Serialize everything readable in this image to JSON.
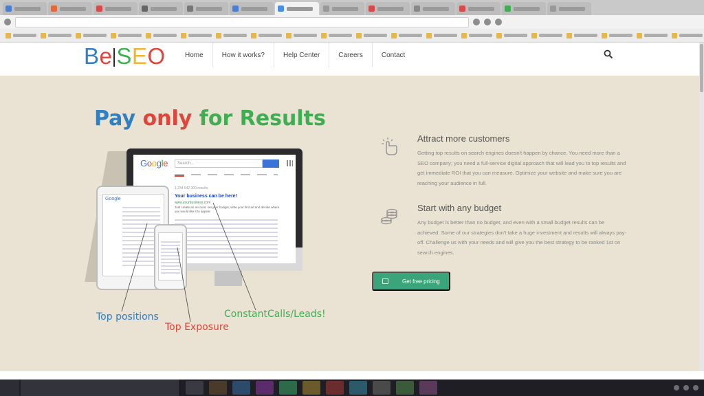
{
  "site": {
    "logo": {
      "b": "B",
      "e": "e",
      "s": "S",
      "e2": "E",
      "o": "O"
    },
    "nav": [
      "Home",
      "How it works?",
      "Help Center",
      "Careers",
      "Contact"
    ]
  },
  "hero": {
    "headline": {
      "w1": "Pay",
      "w2": "only",
      "w3": "for Results"
    },
    "illustration": {
      "search_placeholder": "Search...",
      "results_count": "1 234 542 300 results",
      "result_title": "Your business can be here!",
      "result_url": "www.yourbusiness.com",
      "result_desc": "Just create an account, set your budget, write your first ad and decide where you would like it to appear"
    },
    "labels": {
      "top_positions": "Top positions",
      "top_exposure": "Top Exposure",
      "calls": "ConstantCalls/Leads!"
    }
  },
  "features": [
    {
      "icon": "touch-click-icon",
      "title": "Attract more customers",
      "body": "Getting top results on search engines doesn't happen by chance. You need more than a SEO company; you need a full-service digital approach that will lead you to top results and get immediate ROI that you can measure. Optimize your website and make sure you are reaching your audience in full."
    },
    {
      "icon": "coins-icon",
      "title": "Start with any budget",
      "body": "Any budget is better than no budget, and even with a small budget results can be achieved. Some of our strategies don't take a huge investment and results will always pay-off. Challenge us with your needs and will give you the best strategy to be ranked 1st on search engines."
    }
  ],
  "cta": {
    "label": "Get free pricing",
    "icon": "calculator-icon"
  },
  "colors": {
    "blue": "#2f7fc4",
    "red": "#e0443a",
    "green": "#3fae53",
    "yellow": "#f1b52f",
    "hero_bg": "#eae2d2",
    "cta_bg": "#3aa57a"
  }
}
